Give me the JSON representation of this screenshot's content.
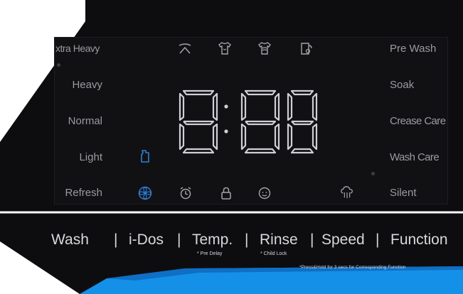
{
  "display": {
    "time_text": "8:88",
    "left_labels": [
      "xtra Heavy",
      "Heavy",
      "Normal",
      "Light",
      "Refresh"
    ],
    "right_labels": [
      "Pre Wash",
      "Soak",
      "Crease Care",
      "Wash Care",
      "Silent"
    ]
  },
  "icons": {
    "top": [
      "quick-wash-icon",
      "shirt-icon",
      "wool-icon",
      "towel-icon"
    ],
    "bottom": [
      "fan-icon",
      "alarm-clock-icon",
      "lock-icon",
      "baby-icon",
      "steam-icon"
    ],
    "detergent": "detergent-bottle-icon"
  },
  "buttons": {
    "wash": "Wash",
    "idos": "i-Dos",
    "temp": "Temp.",
    "rinse": "Rinse",
    "speed": "Speed",
    "function": "Function",
    "separator": "|"
  },
  "sublabels": {
    "pre_delay": "* Pre Delay",
    "child_lock": "* Child Lock",
    "note": "*Press&Hold for 3 secs for Corresponding Function"
  },
  "colors": {
    "panel": "#0d0d10",
    "display_bg": "#111114",
    "label": "#9a9aa0",
    "icon_gray": "#a4a4aa",
    "icon_blue": "#2f7fd8",
    "accent_blue": "#1590e8",
    "text_white": "#d8d8dc"
  }
}
